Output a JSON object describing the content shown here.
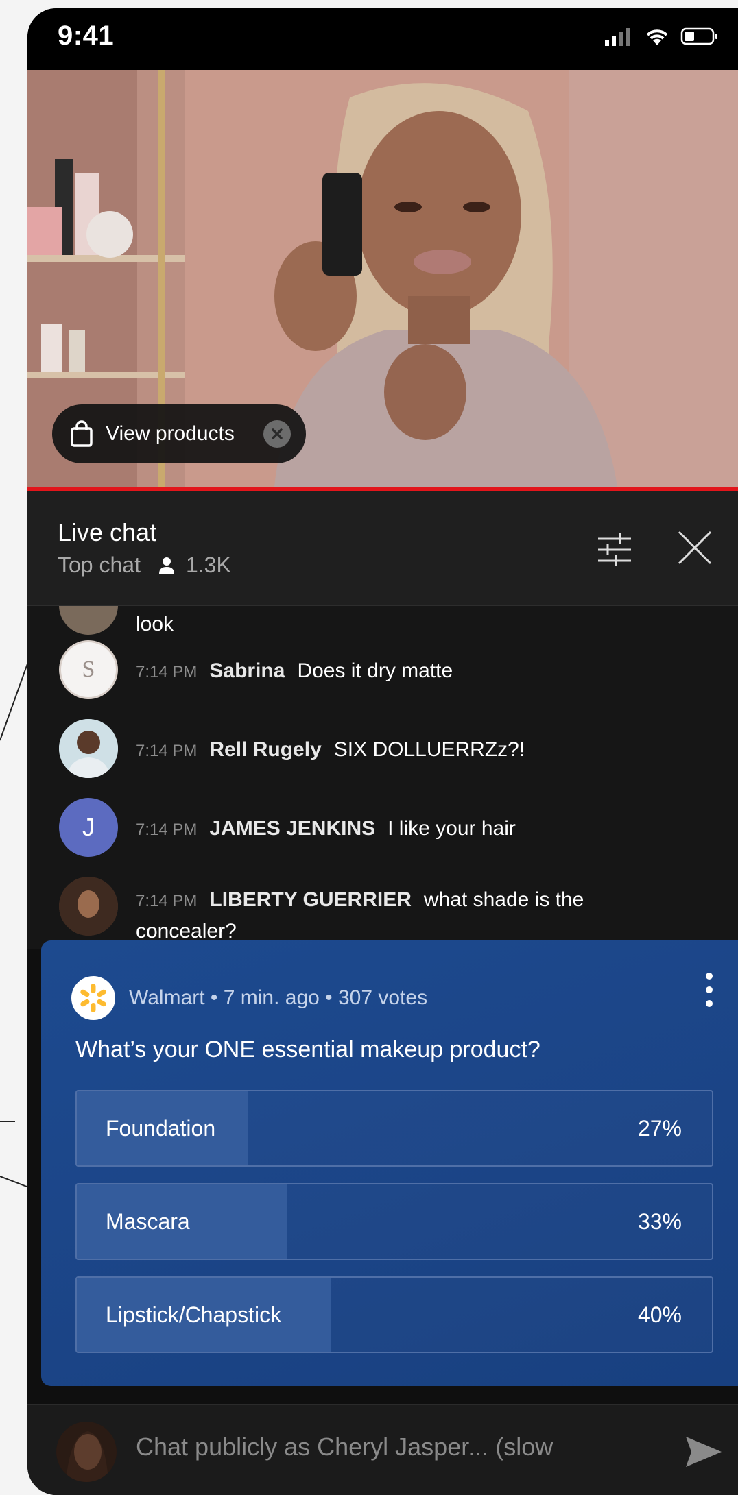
{
  "status_bar": {
    "time": "9:41"
  },
  "video": {
    "view_products_label": "View products"
  },
  "chat_header": {
    "title": "Live chat",
    "mode": "Top chat",
    "viewer_count": "1.3K"
  },
  "messages": [
    {
      "time": "",
      "author": "",
      "text": "look",
      "avatar": "partial-avatar"
    },
    {
      "time": "7:14 PM",
      "author": "Sabrina",
      "text": "Does it dry matte",
      "avatar": "S"
    },
    {
      "time": "7:14 PM",
      "author": "Rell Rugely",
      "text": "SIX DOLLUERRZz?!",
      "avatar": "photo"
    },
    {
      "time": "7:14 PM",
      "author": "JAMES JENKINS",
      "text": "I like your hair",
      "avatar": "J"
    },
    {
      "time": "7:14 PM",
      "author": "LIBERTY GUERRIER",
      "text": "what shade is the concealer?",
      "avatar": "photo"
    }
  ],
  "poll": {
    "meta": "Walmart • 7 min. ago • 307 votes",
    "question": "What’s your ONE essential makeup product?",
    "options": [
      {
        "label": "Foundation",
        "percent_text": "27%",
        "percent": 27
      },
      {
        "label": "Mascara",
        "percent_text": "33%",
        "percent": 33
      },
      {
        "label": "Lipstick/Chapstick",
        "percent_text": "40%",
        "percent": 40
      }
    ]
  },
  "composer": {
    "placeholder": "Chat publicly as Cheryl Jasper... (slow"
  },
  "colors": {
    "accent_red": "#e2151b",
    "poll_bg": "#1d4a8f",
    "poll_fill": "#345c9c",
    "walmart_yellow": "#fdbb30"
  }
}
